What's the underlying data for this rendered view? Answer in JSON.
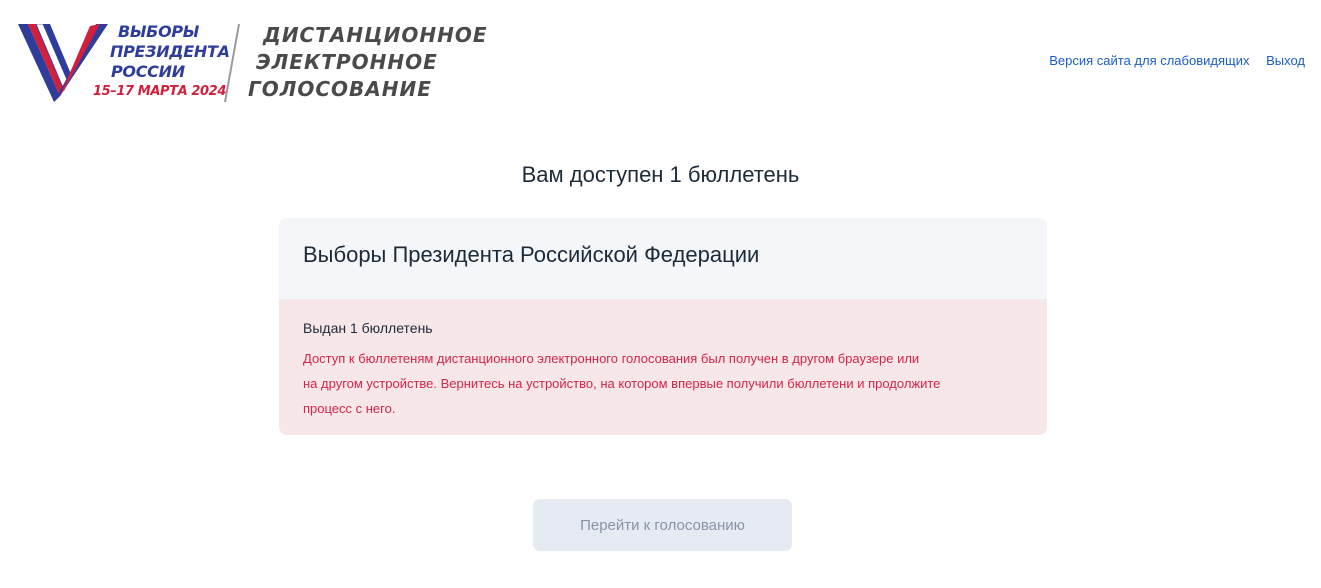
{
  "header": {
    "logo": {
      "election_line1": "ВЫБОРЫ",
      "election_line2": "ПРЕЗИДЕНТА",
      "election_line3": "РОССИИ",
      "date": "15–17 МАРТА 2024",
      "dist_line1": "ДИСТАНЦИОННОЕ",
      "dist_line2": "ЭЛЕКТРОННОЕ",
      "dist_line3": "ГОЛОСОВАНИЕ",
      "colors": {
        "white": "#ffffff",
        "blue": "#2f3d9a",
        "red": "#d21f3c"
      }
    },
    "links": {
      "accessibility": "Версия сайта для слабовидящих",
      "logout": "Выход"
    }
  },
  "main": {
    "title": "Вам доступен 1 бюллетень",
    "card": {
      "election_name": "Выборы Президента Российской Федерации",
      "issued": "Выдан 1 бюллетень",
      "warning_line1": "Доступ к бюллетеням дистанционного электронного голосования был получен в другом браузере или",
      "warning_line2": "на другом устройстве. Вернитесь на устройство, на котором впервые получили бюллетени и продолжите",
      "warning_line3": "процесс с него."
    },
    "vote_button": "Перейти к голосованию"
  }
}
